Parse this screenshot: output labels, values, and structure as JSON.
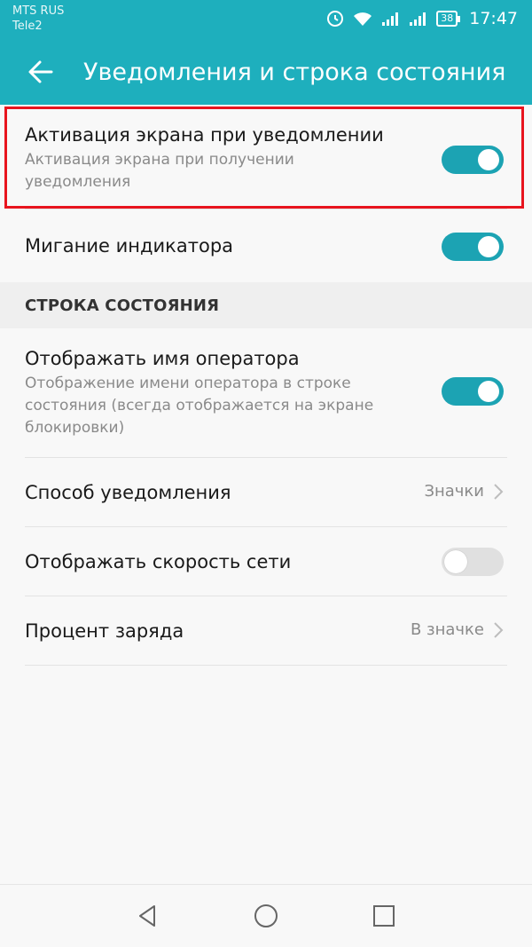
{
  "status_bar": {
    "carrier1": "MTS RUS",
    "carrier2": "Tele2",
    "battery": "38",
    "time": "17:47"
  },
  "toolbar": {
    "title": "Уведомления и строка состояния"
  },
  "rows": {
    "wake_screen": {
      "title": "Активация экрана при уведомлении",
      "subtitle": "Активация экрана при получении уведомления",
      "enabled": true
    },
    "led_blink": {
      "title": "Мигание индикатора",
      "enabled": true
    }
  },
  "status_section": {
    "header": "СТРОКА СОСТОЯНИЯ",
    "show_carrier": {
      "title": "Отображать имя оператора",
      "subtitle": "Отображение имени оператора в строке состояния (всегда отображается на экране блокировки)",
      "enabled": true
    },
    "notification_method": {
      "title": "Способ уведомления",
      "value": "Значки"
    },
    "network_speed": {
      "title": "Отображать скорость сети",
      "enabled": false
    },
    "battery_percent": {
      "title": "Процент заряда",
      "value": "В значке"
    }
  },
  "colors": {
    "accent": "#1eafbd",
    "toggle_on": "#1ca3b3",
    "highlight": "#e8141e"
  },
  "icons": [
    "back-arrow-icon",
    "wifi-icon",
    "signal-icon",
    "battery-icon",
    "chevron-right-icon",
    "nav-back-icon",
    "nav-home-icon",
    "nav-recents-icon"
  ]
}
